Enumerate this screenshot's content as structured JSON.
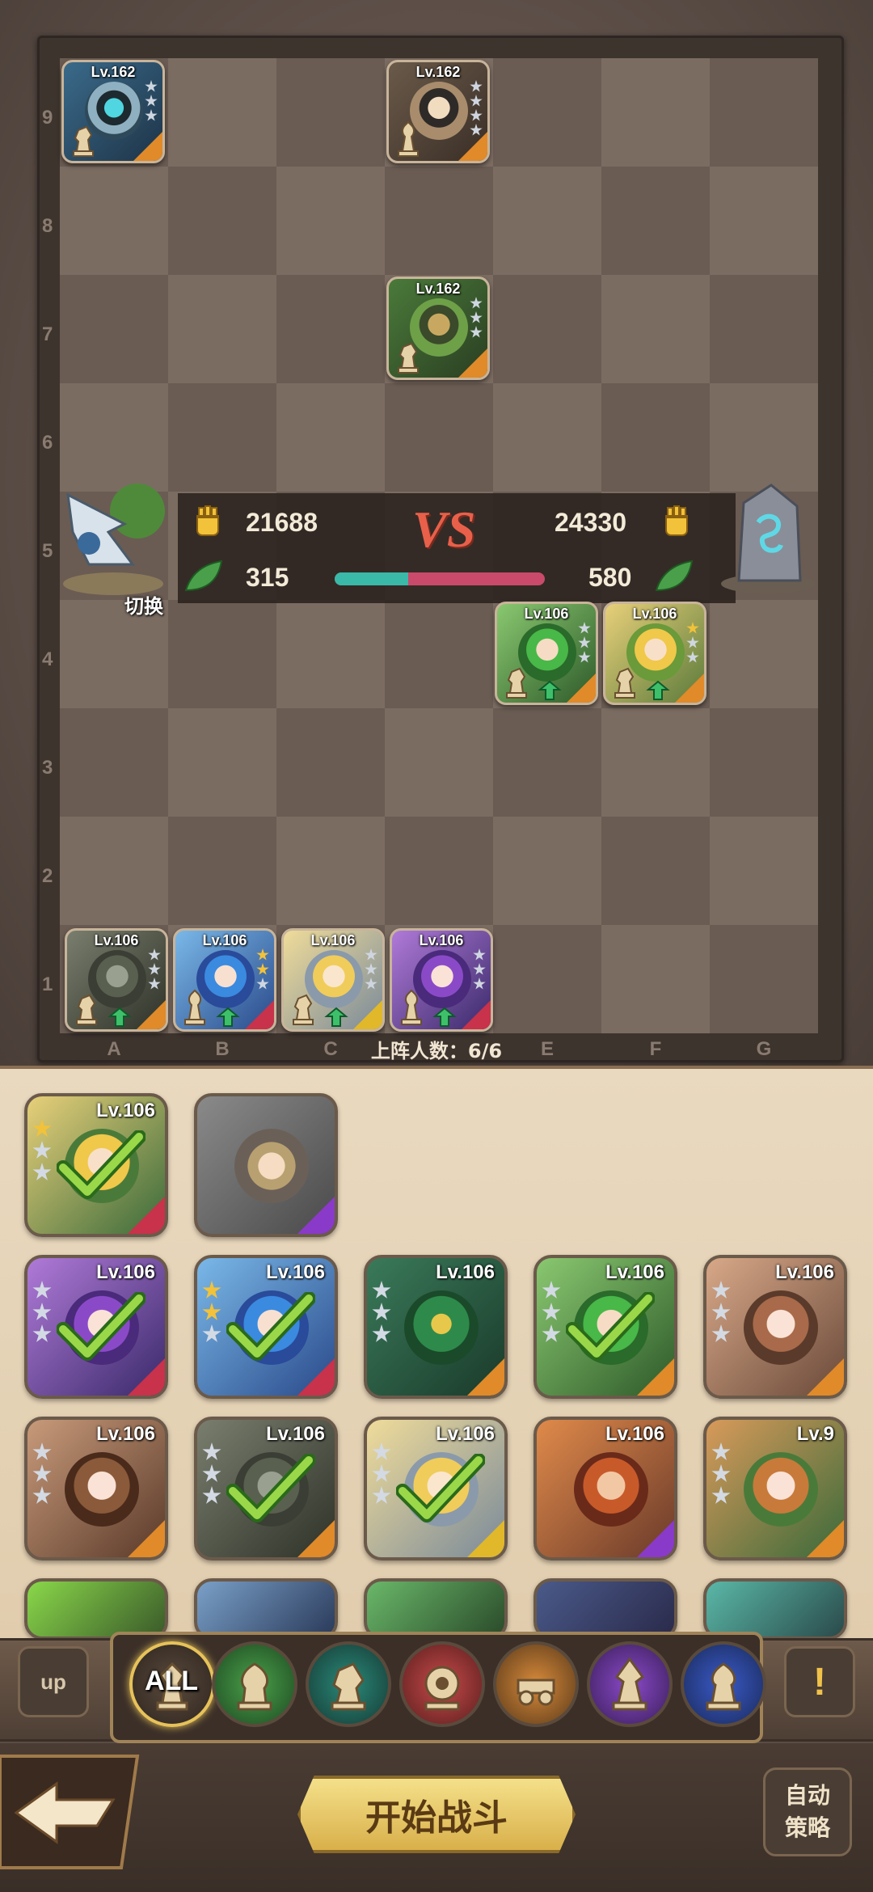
{
  "board": {
    "row_labels": [
      "9",
      "8",
      "7",
      "6",
      "5",
      "4",
      "3",
      "2",
      "1"
    ],
    "col_labels": [
      "A",
      "B",
      "C",
      "D",
      "E",
      "F",
      "G"
    ]
  },
  "enemy_tokens": [
    {
      "level": "Lv.162"
    },
    {
      "level": "Lv.162"
    },
    {
      "level": "Lv.162"
    }
  ],
  "ally_tokens": [
    {
      "level": "Lv.106"
    },
    {
      "level": "Lv.106"
    },
    {
      "level": "Lv.106"
    },
    {
      "level": "Lv.106"
    },
    {
      "level": "Lv.106"
    },
    {
      "level": "Lv.106"
    }
  ],
  "vs_panel": {
    "left_power": "21688",
    "left_secondary": "315",
    "right_power": "24330",
    "right_secondary": "580",
    "vs_label": "VS",
    "switch_label": "切换",
    "balance_left_fraction": 0.35
  },
  "lineup_count_label": "上阵人数：6/6",
  "roster": {
    "top_row": [
      {
        "level": "Lv.106",
        "selected": true
      },
      {
        "level": "",
        "selected": false
      }
    ],
    "row2": [
      {
        "level": "Lv.106",
        "selected": true
      },
      {
        "level": "Lv.106",
        "selected": true
      },
      {
        "level": "Lv.106",
        "selected": false
      },
      {
        "level": "Lv.106",
        "selected": true
      },
      {
        "level": "Lv.106",
        "selected": false
      }
    ],
    "row3": [
      {
        "level": "Lv.106",
        "selected": false
      },
      {
        "level": "Lv.106",
        "selected": true
      },
      {
        "level": "Lv.106",
        "selected": true
      },
      {
        "level": "Lv.106",
        "selected": false
      },
      {
        "level": "Lv.9",
        "selected": false
      }
    ]
  },
  "filter": {
    "all_label": "ALL",
    "up_label": "up",
    "alert_label": "!"
  },
  "bottom": {
    "start_label": "开始战斗",
    "auto_label_line1": "自动",
    "auto_label_line2": "策略"
  },
  "colors": {
    "ally_bar": "#3ab8a8",
    "enemy_bar": "#c94a6a",
    "vs": "#e8604a",
    "accent_gold": "#e6c25a"
  }
}
